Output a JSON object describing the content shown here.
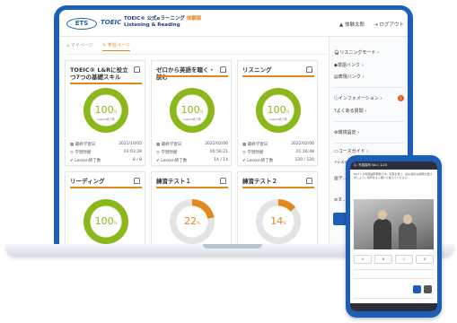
{
  "header": {
    "brand": "TOEIC",
    "app_title_line1": "TOEIC® 公式eラーニング",
    "badge": "体験版",
    "app_title_line2": "Listening & Reading",
    "user": "体験太郎",
    "logout": "ログアウト"
  },
  "tabs": [
    "マイページ",
    "学習ページ"
  ],
  "cards": [
    {
      "title": "TOEIC® L&Rに役立つ7つの基礎スキル",
      "percent": "100",
      "ring_label": "Lesson修了率",
      "stats": [
        {
          "label": "最終学習日",
          "value": "2021/10/05"
        },
        {
          "label": "学習時間",
          "value": "03:03:28"
        },
        {
          "label": "Lesson修了数",
          "value": "8 / 8"
        }
      ]
    },
    {
      "title": "ゼロから英語を聴く・読む",
      "percent": "100",
      "ring_label": "Lesson修了率",
      "stats": [
        {
          "label": "最終学習日",
          "value": "2022/02/06"
        },
        {
          "label": "学習時間",
          "value": "00:56:21"
        },
        {
          "label": "Lesson修了数",
          "value": "14 / 14"
        }
      ]
    },
    {
      "title": "リスニング",
      "percent": "100",
      "ring_label": "Lesson修了率",
      "stats": [
        {
          "label": "最終学習日",
          "value": "2022/02/06"
        },
        {
          "label": "学習時間",
          "value": "01:16:48"
        },
        {
          "label": "Lesson修了数",
          "value": "120 / 120"
        }
      ]
    },
    {
      "title": "リーディング",
      "percent": "100",
      "progress": 1.0
    },
    {
      "title": "練習テスト１",
      "percent": "22",
      "progress": 0.22
    },
    {
      "title": "練習テスト２",
      "percent": "14",
      "progress": 0.14
    }
  ],
  "sidebar": {
    "items": [
      "リスニングモード",
      "単語バンク",
      "表現バンク",
      "インフォメーション",
      "よくある質問",
      "環境設定",
      "コースガイド",
      "システム動作環境/推奨ブラウザー",
      "テ…",
      "ヌ…"
    ],
    "notice_count": "1"
  },
  "phone": {
    "title": "Q. 写真描写 No.1  1/20",
    "text": "Part 1 の写真描写問題です。写真を見て、最も適切な説明を選びましょう。音声をよく聞いて答えてください。",
    "options": [
      "A",
      "B",
      "C",
      "D"
    ]
  },
  "colors": {
    "brand_blue": "#1d5fb8",
    "accent_orange": "#e2861e",
    "ring_green": "#8ab81a"
  }
}
